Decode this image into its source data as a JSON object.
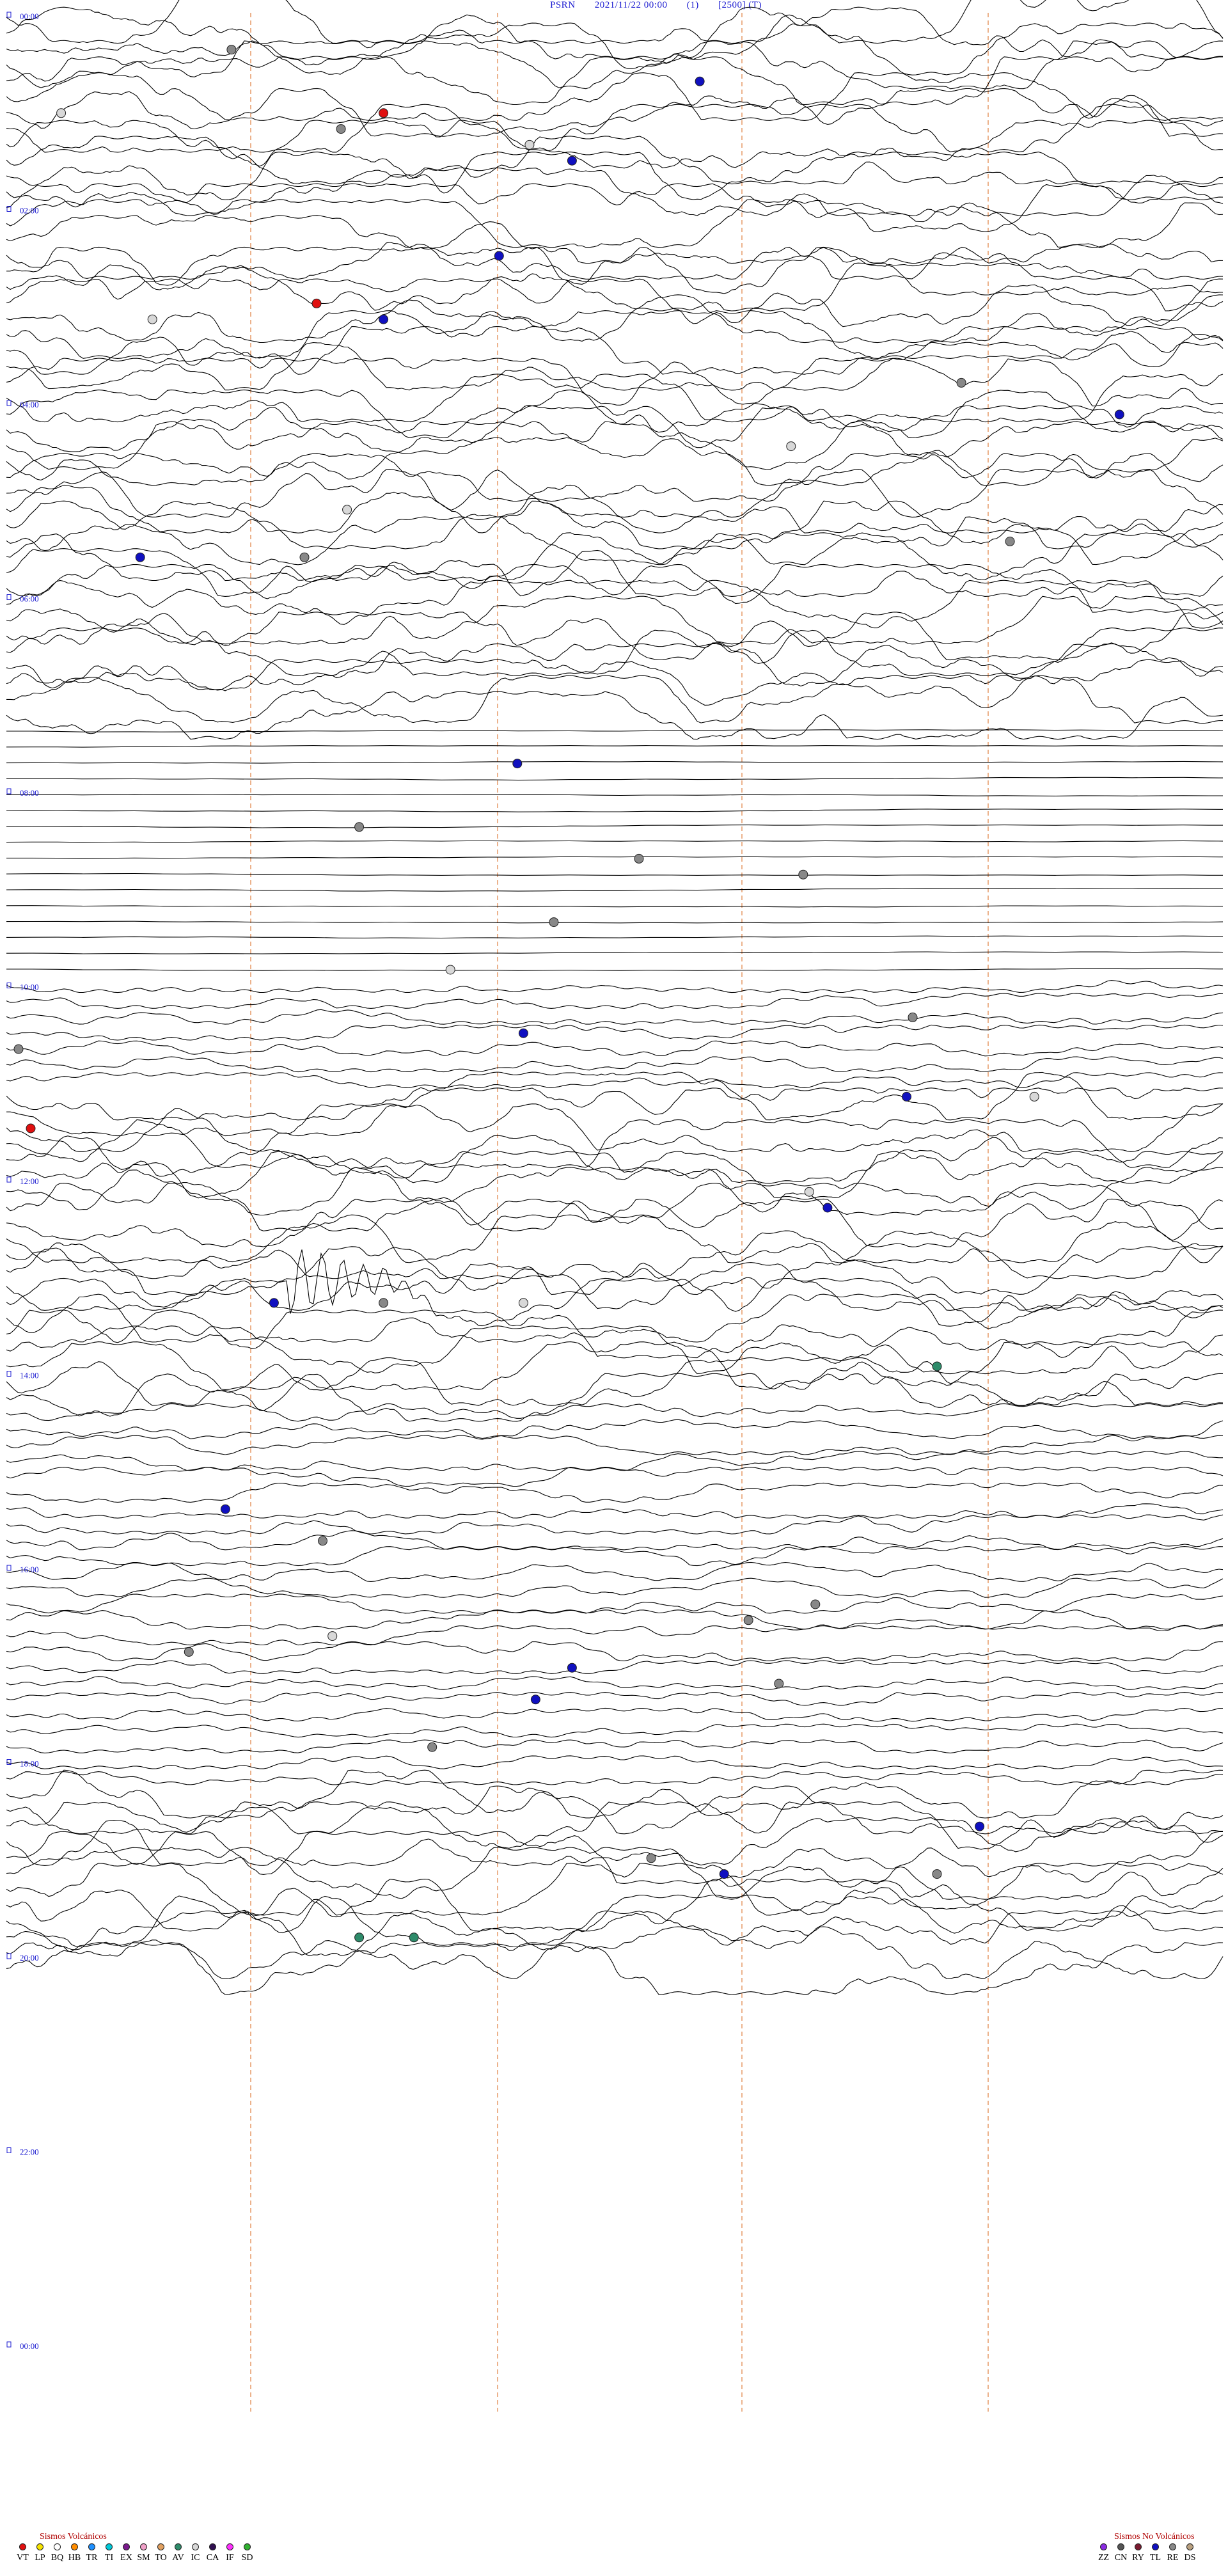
{
  "header": {
    "station": "PSRN",
    "datetime": "2021/11/22 00:00",
    "channel": "(1)",
    "scale": "[2500] (T)"
  },
  "time_labels": [
    "00:00",
    "02:00",
    "04:00",
    "06:00",
    "08:00",
    "10:00",
    "12:00",
    "14:00",
    "16:00",
    "18:00",
    "20:00",
    "22:00",
    "00:00"
  ],
  "events": [
    {
      "row": 2,
      "x": 0.185,
      "type": "RE"
    },
    {
      "row": 4,
      "x": 0.57,
      "type": "TL"
    },
    {
      "row": 6,
      "x": 0.045,
      "type": "IC"
    },
    {
      "row": 6,
      "x": 0.31,
      "type": "VT"
    },
    {
      "row": 7,
      "x": 0.275,
      "type": "RE"
    },
    {
      "row": 8,
      "x": 0.43,
      "type": "IC"
    },
    {
      "row": 9,
      "x": 0.465,
      "type": "TL"
    },
    {
      "row": 15,
      "x": 0.405,
      "type": "TL"
    },
    {
      "row": 18,
      "x": 0.255,
      "type": "VT"
    },
    {
      "row": 19,
      "x": 0.31,
      "type": "TL"
    },
    {
      "row": 19,
      "x": 0.12,
      "type": "IC"
    },
    {
      "row": 23,
      "x": 0.785,
      "type": "RE"
    },
    {
      "row": 25,
      "x": 0.915,
      "type": "TL"
    },
    {
      "row": 27,
      "x": 0.645,
      "type": "IC"
    },
    {
      "row": 31,
      "x": 0.28,
      "type": "IC"
    },
    {
      "row": 33,
      "x": 0.825,
      "type": "RE"
    },
    {
      "row": 34,
      "x": 0.245,
      "type": "RE"
    },
    {
      "row": 34,
      "x": 0.11,
      "type": "TL"
    },
    {
      "row": 47,
      "x": 0.42,
      "type": "TL"
    },
    {
      "row": 51,
      "x": 0.29,
      "type": "RE"
    },
    {
      "row": 53,
      "x": 0.52,
      "type": "RE"
    },
    {
      "row": 54,
      "x": 0.655,
      "type": "RE"
    },
    {
      "row": 57,
      "x": 0.45,
      "type": "RE"
    },
    {
      "row": 60,
      "x": 0.365,
      "type": "IC"
    },
    {
      "row": 63,
      "x": 0.745,
      "type": "RE"
    },
    {
      "row": 64,
      "x": 0.425,
      "type": "TL"
    },
    {
      "row": 65,
      "x": 0.01,
      "type": "RE"
    },
    {
      "row": 68,
      "x": 0.74,
      "type": "TL"
    },
    {
      "row": 68,
      "x": 0.845,
      "type": "IC"
    },
    {
      "row": 70,
      "x": 0.02,
      "type": "VT"
    },
    {
      "row": 74,
      "x": 0.66,
      "type": "IC"
    },
    {
      "row": 75,
      "x": 0.675,
      "type": "TL"
    },
    {
      "row": 81,
      "x": 0.22,
      "type": "TL"
    },
    {
      "row": 81,
      "x": 0.31,
      "type": "RE"
    },
    {
      "row": 81,
      "x": 0.425,
      "type": "IC"
    },
    {
      "row": 85,
      "x": 0.765,
      "type": "AV"
    },
    {
      "row": 94,
      "x": 0.18,
      "type": "TL"
    },
    {
      "row": 96,
      "x": 0.26,
      "type": "RE"
    },
    {
      "row": 100,
      "x": 0.665,
      "type": "RE"
    },
    {
      "row": 101,
      "x": 0.61,
      "type": "RE"
    },
    {
      "row": 102,
      "x": 0.268,
      "type": "IC"
    },
    {
      "row": 103,
      "x": 0.15,
      "type": "RE"
    },
    {
      "row": 104,
      "x": 0.465,
      "type": "TL"
    },
    {
      "row": 105,
      "x": 0.635,
      "type": "RE"
    },
    {
      "row": 106,
      "x": 0.435,
      "type": "TL"
    },
    {
      "row": 109,
      "x": 0.35,
      "type": "RE"
    },
    {
      "row": 114,
      "x": 0.8,
      "type": "TL"
    },
    {
      "row": 116,
      "x": 0.53,
      "type": "RE"
    },
    {
      "row": 117,
      "x": 0.59,
      "type": "TL"
    },
    {
      "row": 117,
      "x": 0.765,
      "type": "RE"
    },
    {
      "row": 121,
      "x": 0.29,
      "type": "AV"
    },
    {
      "row": 121,
      "x": 0.335,
      "type": "AV"
    }
  ],
  "legend_volcanic": {
    "title": "Sismos Volcánicos",
    "items": [
      {
        "code": "VT",
        "color": "#e01010"
      },
      {
        "code": "LP",
        "color": "#f5e200"
      },
      {
        "code": "BQ",
        "color": "#ffffff"
      },
      {
        "code": "HB",
        "color": "#ff8c00"
      },
      {
        "code": "TR",
        "color": "#1e90ff"
      },
      {
        "code": "TI",
        "color": "#00c8d8"
      },
      {
        "code": "EX",
        "color": "#7a1a8c"
      },
      {
        "code": "SM",
        "color": "#f0a0c8"
      },
      {
        "code": "TO",
        "color": "#e0a060"
      },
      {
        "code": "AV",
        "color": "#2e8b6a"
      },
      {
        "code": "IC",
        "color": "#d8d8d8"
      },
      {
        "code": "CA",
        "color": "#301050"
      },
      {
        "code": "IF",
        "color": "#ff30ff"
      },
      {
        "code": "SD",
        "color": "#30b030"
      }
    ]
  },
  "legend_nonvolcanic": {
    "title": "Sismos No Volcánicos",
    "items": [
      {
        "code": "ZZ",
        "color": "#8a2be2"
      },
      {
        "code": "CN",
        "color": "#555555"
      },
      {
        "code": "RY",
        "color": "#7a1a30"
      },
      {
        "code": "TL",
        "color": "#1010c0"
      },
      {
        "code": "RE",
        "color": "#888888"
      },
      {
        "code": "DS",
        "color": "#b8a080"
      }
    ]
  },
  "colors": {
    "trace": "#000000",
    "gridline": "#e08040",
    "header": "#1a1ad0",
    "legend_title": "#b00000",
    "time_label": "#1a1ad0"
  }
}
